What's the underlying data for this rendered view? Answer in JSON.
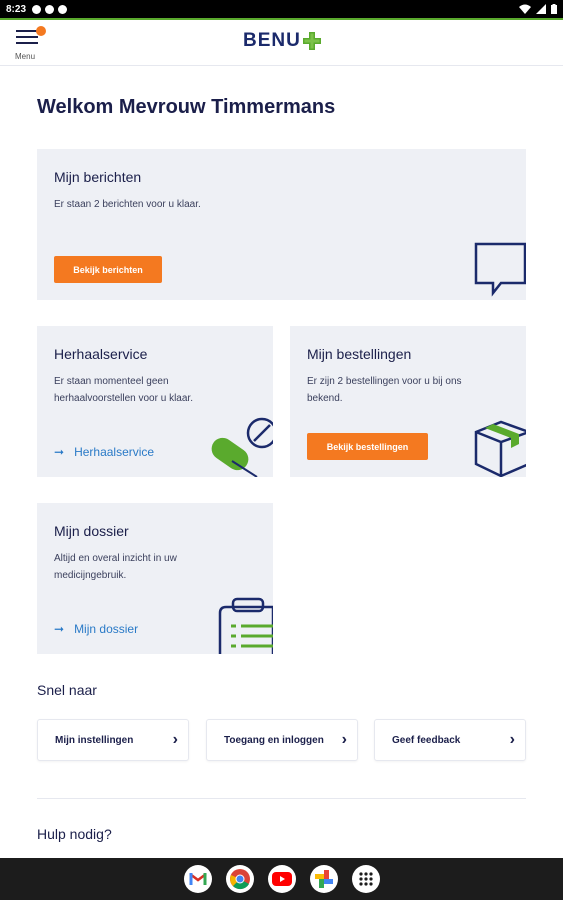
{
  "status": {
    "time": "8:23"
  },
  "header": {
    "menu_label": "Menu",
    "logo_text": "BENU"
  },
  "welcome": "Welkom Mevrouw Timmermans",
  "cards": {
    "berichten": {
      "title": "Mijn berichten",
      "text": "Er staan 2 berichten voor u klaar.",
      "button": "Bekijk berichten"
    },
    "herhaal": {
      "title": "Herhaalservice",
      "text": "Er staan momenteel geen herhaalvoorstellen voor u klaar.",
      "link": "Herhaalservice"
    },
    "bestellingen": {
      "title": "Mijn bestellingen",
      "text": "Er zijn 2 bestellingen voor u bij ons bekend.",
      "button": "Bekijk bestellingen"
    },
    "dossier": {
      "title": "Mijn dossier",
      "text": "Altijd en overal inzicht in uw medicijngebruik.",
      "link": "Mijn dossier"
    }
  },
  "snel_naar": {
    "heading": "Snel naar",
    "items": [
      {
        "label": "Mijn instellingen"
      },
      {
        "label": "Toegang en inloggen"
      },
      {
        "label": "Geef feedback"
      }
    ]
  },
  "help": {
    "heading": "Hulp nodig?"
  },
  "colors": {
    "brand_navy": "#1b2a6b",
    "accent_orange": "#f47920",
    "brand_green": "#5aaa2d",
    "link_blue": "#2a7ac7",
    "card_bg": "#eef0f5"
  },
  "nav_apps": [
    "gmail-icon",
    "chrome-icon",
    "youtube-icon",
    "photos-icon",
    "apps-icon"
  ]
}
